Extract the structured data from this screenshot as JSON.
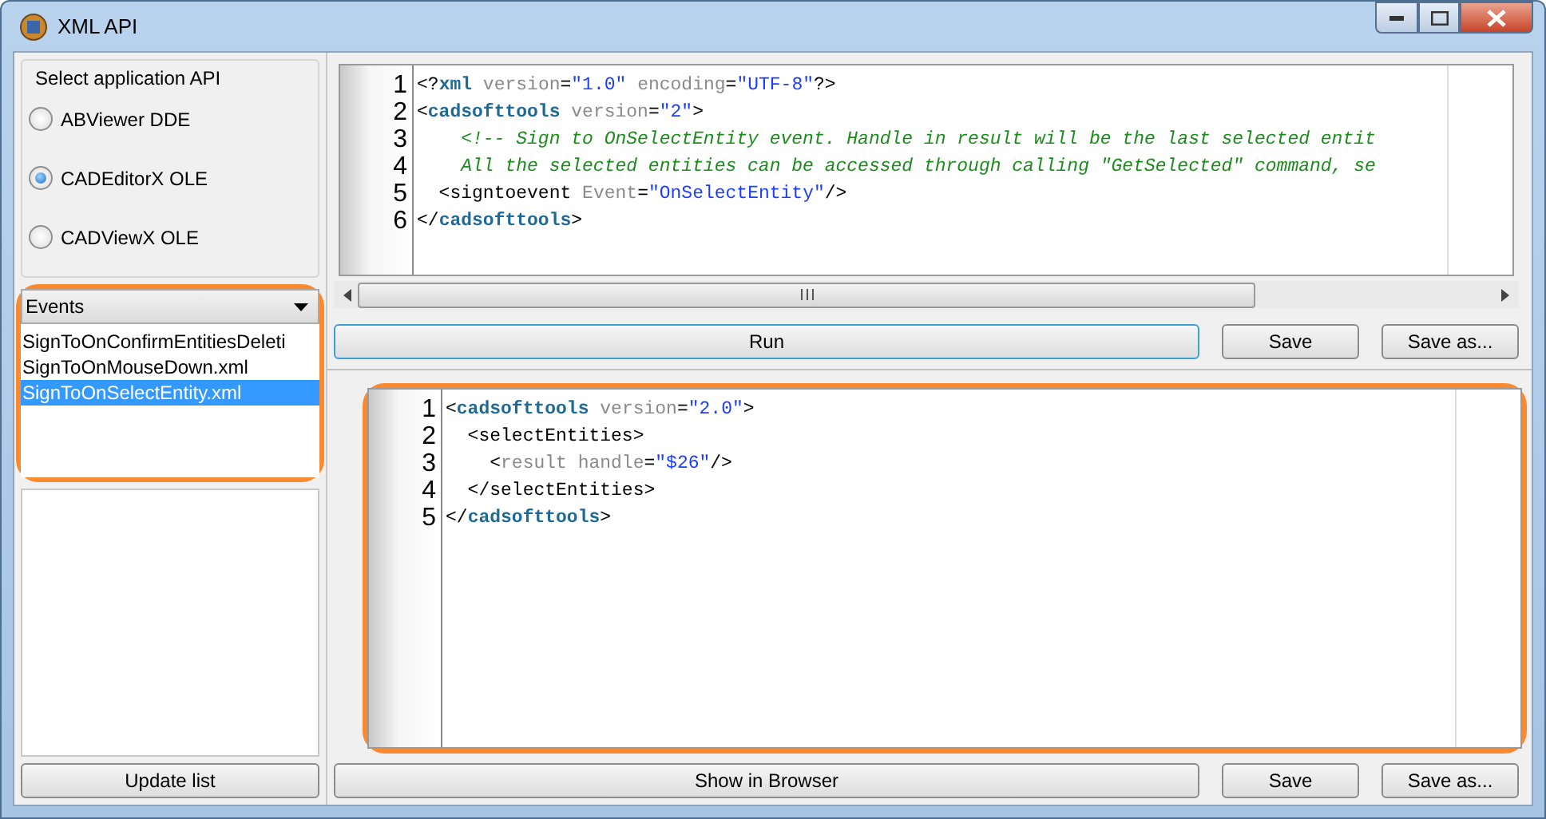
{
  "window": {
    "title": "XML API"
  },
  "api_group": {
    "title": "Select application API",
    "options": [
      {
        "label": "ABViewer DDE",
        "selected": false
      },
      {
        "label": "CADEditorX OLE",
        "selected": true
      },
      {
        "label": "CADViewX OLE",
        "selected": false
      }
    ]
  },
  "events": {
    "highlighted": true,
    "dropdown": {
      "value": "Events"
    },
    "items": [
      {
        "label": "SignToOnConfirmEntitiesDeleti",
        "selected": false
      },
      {
        "label": "SignToOnMouseDown.xml",
        "selected": false
      },
      {
        "label": "SignToOnSelectEntity.xml",
        "selected": true
      }
    ]
  },
  "update_button": "Update list",
  "request_editor": {
    "highlighted": false,
    "lines": [
      {
        "number": "1",
        "tokens": [
          {
            "kind": "punct",
            "text": "<?"
          },
          {
            "kind": "tag",
            "text": "xml"
          },
          {
            "kind": "attr",
            "text": " version"
          },
          {
            "kind": "punct",
            "text": "="
          },
          {
            "kind": "value",
            "text": "\"1.0\""
          },
          {
            "kind": "attr",
            "text": " encoding"
          },
          {
            "kind": "punct",
            "text": "="
          },
          {
            "kind": "value",
            "text": "\"UTF-8\""
          },
          {
            "kind": "punct",
            "text": "?>"
          }
        ]
      },
      {
        "number": "2",
        "tokens": [
          {
            "kind": "punct",
            "text": "<"
          },
          {
            "kind": "tag",
            "text": "cadsofttools"
          },
          {
            "kind": "attr",
            "text": " version"
          },
          {
            "kind": "punct",
            "text": "="
          },
          {
            "kind": "value",
            "text": "\"2\""
          },
          {
            "kind": "punct",
            "text": ">"
          }
        ]
      },
      {
        "number": "3",
        "tokens": [
          {
            "kind": "comment",
            "text": "    <!-- Sign to OnSelectEntity event. Handle in result will be the last selected entit"
          }
        ]
      },
      {
        "number": "4",
        "tokens": [
          {
            "kind": "comment",
            "text": "    All the selected entities can be accessed through calling \"GetSelected\" command, se"
          }
        ]
      },
      {
        "number": "5",
        "tokens": [
          {
            "kind": "punct",
            "text": "  <"
          },
          {
            "kind": "plain",
            "text": "signtoevent"
          },
          {
            "kind": "attr",
            "text": " Event"
          },
          {
            "kind": "punct",
            "text": "="
          },
          {
            "kind": "value",
            "text": "\"OnSelectEntity\""
          },
          {
            "kind": "punct",
            "text": "/>"
          }
        ]
      },
      {
        "number": "6",
        "tokens": [
          {
            "kind": "punct",
            "text": "</"
          },
          {
            "kind": "tag",
            "text": "cadsofttools"
          },
          {
            "kind": "punct",
            "text": ">"
          }
        ]
      }
    ]
  },
  "request_buttons": {
    "run": "Run",
    "save": "Save",
    "save_as": "Save as..."
  },
  "result_editor": {
    "highlighted": true,
    "lines": [
      {
        "number": "1",
        "tokens": [
          {
            "kind": "punct",
            "text": "<"
          },
          {
            "kind": "tag",
            "text": "cadsofttools"
          },
          {
            "kind": "attr",
            "text": " version"
          },
          {
            "kind": "punct",
            "text": "="
          },
          {
            "kind": "value",
            "text": "\"2.0\""
          },
          {
            "kind": "punct",
            "text": ">"
          }
        ]
      },
      {
        "number": "2",
        "tokens": [
          {
            "kind": "punct",
            "text": "  <"
          },
          {
            "kind": "plain",
            "text": "selectEntities"
          },
          {
            "kind": "punct",
            "text": ">"
          }
        ]
      },
      {
        "number": "3",
        "tokens": [
          {
            "kind": "punct",
            "text": "    <"
          },
          {
            "kind": "attr",
            "text": "result handle"
          },
          {
            "kind": "punct",
            "text": "="
          },
          {
            "kind": "value",
            "text": "\"$26\""
          },
          {
            "kind": "punct",
            "text": "/>"
          }
        ]
      },
      {
        "number": "4",
        "tokens": [
          {
            "kind": "punct",
            "text": "  </"
          },
          {
            "kind": "plain",
            "text": "selectEntities"
          },
          {
            "kind": "punct",
            "text": ">"
          }
        ]
      },
      {
        "number": "5",
        "tokens": [
          {
            "kind": "punct",
            "text": "</"
          },
          {
            "kind": "tag",
            "text": "cadsofttools"
          },
          {
            "kind": "punct",
            "text": ">"
          }
        ]
      }
    ]
  },
  "result_buttons": {
    "show": "Show in Browser",
    "save": "Save",
    "save_as": "Save as..."
  }
}
